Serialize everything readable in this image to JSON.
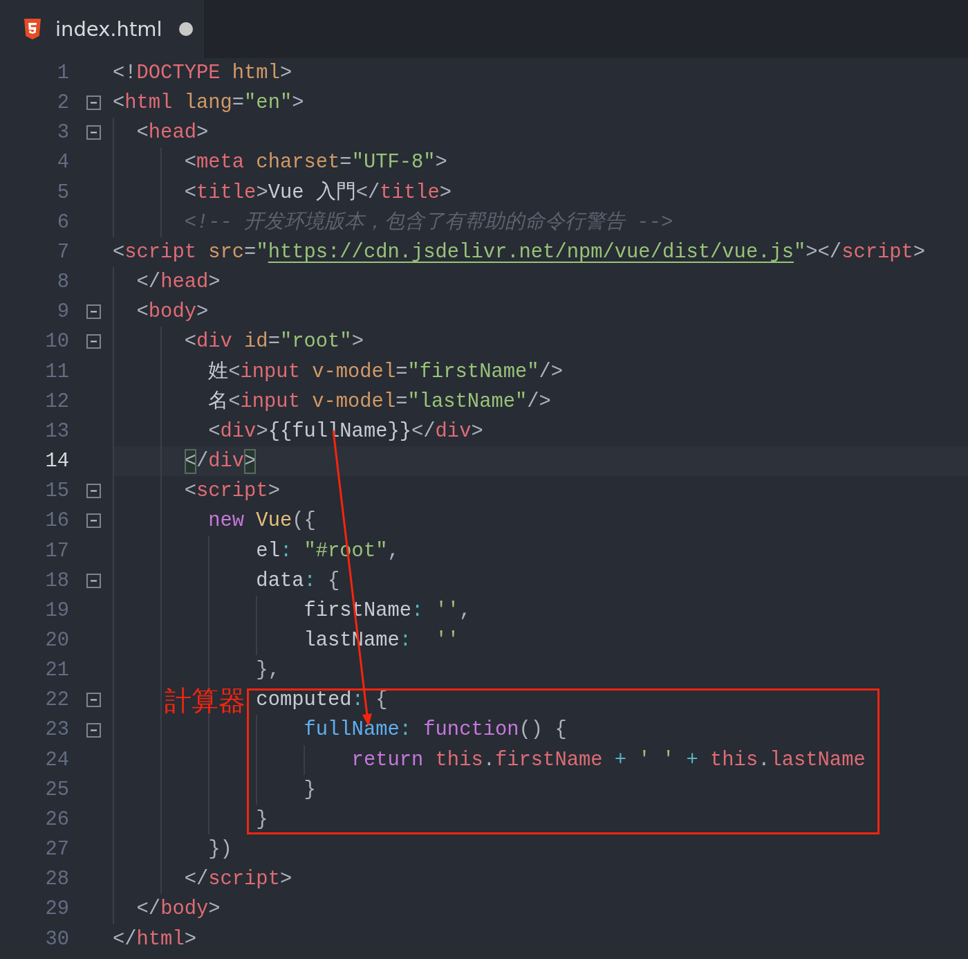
{
  "tab": {
    "filename": "index.html",
    "selected": true,
    "modified": true
  },
  "lines": [
    {
      "number": "1",
      "fold": false,
      "selected": false,
      "tokens": [
        {
          "text": "<!",
          "kind": "punct"
        },
        {
          "text": "DOCTYPE",
          "kind": "tag"
        },
        {
          "text": " html",
          "kind": "attr"
        },
        {
          "text": ">",
          "kind": "punct"
        }
      ]
    },
    {
      "number": "2",
      "fold": true,
      "selected": false,
      "tokens": [
        {
          "text": "<",
          "kind": "punct"
        },
        {
          "text": "html",
          "kind": "tag"
        },
        {
          "text": " lang",
          "kind": "attr"
        },
        {
          "text": "=",
          "kind": "punct"
        },
        {
          "text": "\"en\"",
          "kind": "string"
        },
        {
          "text": ">",
          "kind": "punct"
        }
      ]
    },
    {
      "number": "3",
      "fold": true,
      "selected": false,
      "tokens": [
        {
          "text": "  <",
          "kind": "punct"
        },
        {
          "text": "head",
          "kind": "tag"
        },
        {
          "text": ">",
          "kind": "punct"
        }
      ]
    },
    {
      "number": "4",
      "fold": false,
      "selected": false,
      "tokens": [
        {
          "text": "      <",
          "kind": "punct"
        },
        {
          "text": "meta",
          "kind": "tag"
        },
        {
          "text": " charset",
          "kind": "attr"
        },
        {
          "text": "=",
          "kind": "punct"
        },
        {
          "text": "\"UTF-8\"",
          "kind": "string"
        },
        {
          "text": ">",
          "kind": "punct"
        }
      ]
    },
    {
      "number": "5",
      "fold": false,
      "selected": false,
      "tokens": [
        {
          "text": "      <",
          "kind": "punct"
        },
        {
          "text": "title",
          "kind": "tag"
        },
        {
          "text": ">",
          "kind": "punct"
        },
        {
          "text": "Vue 入門",
          "kind": "text"
        },
        {
          "text": "</",
          "kind": "punct"
        },
        {
          "text": "title",
          "kind": "tag"
        },
        {
          "text": ">",
          "kind": "punct"
        }
      ]
    },
    {
      "number": "6",
      "fold": false,
      "selected": false,
      "tokens": [
        {
          "text": "      <!-- 开发环境版本，包含了有帮助的命令行警告 -->",
          "kind": "comment"
        }
      ]
    },
    {
      "number": "7",
      "fold": false,
      "selected": false,
      "tokens": [
        {
          "text": "<",
          "kind": "punct"
        },
        {
          "text": "script",
          "kind": "tag"
        },
        {
          "text": " src",
          "kind": "attr"
        },
        {
          "text": "=",
          "kind": "punct"
        },
        {
          "text": "\"",
          "kind": "string"
        },
        {
          "text": "https://cdn.jsdelivr.net/npm/vue/dist/vue.js",
          "kind": "link"
        },
        {
          "text": "\"",
          "kind": "string"
        },
        {
          "text": "></",
          "kind": "punct"
        },
        {
          "text": "script",
          "kind": "tag"
        },
        {
          "text": ">",
          "kind": "punct"
        }
      ]
    },
    {
      "number": "8",
      "fold": false,
      "selected": false,
      "tokens": [
        {
          "text": "  </",
          "kind": "punct"
        },
        {
          "text": "head",
          "kind": "tag"
        },
        {
          "text": ">",
          "kind": "punct"
        }
      ]
    },
    {
      "number": "9",
      "fold": true,
      "selected": false,
      "tokens": [
        {
          "text": "  <",
          "kind": "punct"
        },
        {
          "text": "body",
          "kind": "tag"
        },
        {
          "text": ">",
          "kind": "punct"
        }
      ]
    },
    {
      "number": "10",
      "fold": true,
      "selected": false,
      "tokens": [
        {
          "text": "      <",
          "kind": "punct"
        },
        {
          "text": "div",
          "kind": "tag"
        },
        {
          "text": " id",
          "kind": "attr"
        },
        {
          "text": "=",
          "kind": "punct"
        },
        {
          "text": "\"root\"",
          "kind": "string"
        },
        {
          "text": ">",
          "kind": "punct"
        }
      ]
    },
    {
      "number": "11",
      "fold": false,
      "selected": false,
      "tokens": [
        {
          "text": "        姓",
          "kind": "text"
        },
        {
          "text": "<",
          "kind": "punct"
        },
        {
          "text": "input",
          "kind": "tag"
        },
        {
          "text": " v-model",
          "kind": "attr"
        },
        {
          "text": "=",
          "kind": "punct"
        },
        {
          "text": "\"firstName\"",
          "kind": "string"
        },
        {
          "text": "/>",
          "kind": "punct"
        }
      ]
    },
    {
      "number": "12",
      "fold": false,
      "selected": false,
      "tokens": [
        {
          "text": "        名",
          "kind": "text"
        },
        {
          "text": "<",
          "kind": "punct"
        },
        {
          "text": "input",
          "kind": "tag"
        },
        {
          "text": " v-model",
          "kind": "attr"
        },
        {
          "text": "=",
          "kind": "punct"
        },
        {
          "text": "\"lastName\"",
          "kind": "string"
        },
        {
          "text": "/>",
          "kind": "punct"
        }
      ]
    },
    {
      "number": "13",
      "fold": false,
      "selected": false,
      "tokens": [
        {
          "text": "        <",
          "kind": "punct"
        },
        {
          "text": "div",
          "kind": "tag"
        },
        {
          "text": ">",
          "kind": "punct"
        },
        {
          "text": "{{fullName}}",
          "kind": "text"
        },
        {
          "text": "</",
          "kind": "punct"
        },
        {
          "text": "div",
          "kind": "tag"
        },
        {
          "text": ">",
          "kind": "punct"
        }
      ]
    },
    {
      "number": "14",
      "fold": false,
      "selected": true,
      "tokens": [
        {
          "text": "      <",
          "kind": "match"
        },
        {
          "text": "/",
          "kind": "punct"
        },
        {
          "text": "div",
          "kind": "tag"
        },
        {
          "text": ">",
          "kind": "match"
        }
      ]
    },
    {
      "number": "15",
      "fold": true,
      "selected": false,
      "tokens": [
        {
          "text": "      <",
          "kind": "punct"
        },
        {
          "text": "script",
          "kind": "tag"
        },
        {
          "text": ">",
          "kind": "punct"
        }
      ]
    },
    {
      "number": "16",
      "fold": true,
      "selected": false,
      "tokens": [
        {
          "text": "        new",
          "kind": "keyword"
        },
        {
          "text": " Vue",
          "kind": "class"
        },
        {
          "text": "({",
          "kind": "punct"
        }
      ]
    },
    {
      "number": "17",
      "fold": false,
      "selected": false,
      "tokens": [
        {
          "text": "            el",
          "kind": "text"
        },
        {
          "text": ":",
          "kind": "operator"
        },
        {
          "text": " \"#root\"",
          "kind": "string"
        },
        {
          "text": ",",
          "kind": "punct"
        }
      ]
    },
    {
      "number": "18",
      "fold": true,
      "selected": false,
      "tokens": [
        {
          "text": "            data",
          "kind": "text"
        },
        {
          "text": ":",
          "kind": "operator"
        },
        {
          "text": " {",
          "kind": "punct"
        }
      ]
    },
    {
      "number": "19",
      "fold": false,
      "selected": false,
      "tokens": [
        {
          "text": "                firstName",
          "kind": "text"
        },
        {
          "text": ":",
          "kind": "operator"
        },
        {
          "text": " ''",
          "kind": "string"
        },
        {
          "text": ",",
          "kind": "punct"
        }
      ]
    },
    {
      "number": "20",
      "fold": false,
      "selected": false,
      "tokens": [
        {
          "text": "                lastName",
          "kind": "text"
        },
        {
          "text": ":",
          "kind": "operator"
        },
        {
          "text": "  ''",
          "kind": "string"
        }
      ]
    },
    {
      "number": "21",
      "fold": false,
      "selected": false,
      "tokens": [
        {
          "text": "            },",
          "kind": "punct"
        }
      ]
    },
    {
      "number": "22",
      "fold": true,
      "selected": false,
      "tokens": [
        {
          "text": "            computed",
          "kind": "text"
        },
        {
          "text": ":",
          "kind": "operator"
        },
        {
          "text": " {",
          "kind": "punct"
        }
      ]
    },
    {
      "number": "23",
      "fold": true,
      "selected": false,
      "tokens": [
        {
          "text": "                fullName",
          "kind": "property"
        },
        {
          "text": ":",
          "kind": "operator"
        },
        {
          "text": " function",
          "kind": "keyword"
        },
        {
          "text": "() {",
          "kind": "punct"
        }
      ]
    },
    {
      "number": "24",
      "fold": false,
      "selected": false,
      "tokens": [
        {
          "text": "                    return",
          "kind": "keyword"
        },
        {
          "text": " this",
          "kind": "tag"
        },
        {
          "text": ".",
          "kind": "punct"
        },
        {
          "text": "firstName",
          "kind": "tag"
        },
        {
          "text": " +",
          "kind": "operator"
        },
        {
          "text": " ' '",
          "kind": "string"
        },
        {
          "text": " +",
          "kind": "operator"
        },
        {
          "text": " this",
          "kind": "tag"
        },
        {
          "text": ".",
          "kind": "punct"
        },
        {
          "text": "lastName",
          "kind": "tag"
        }
      ]
    },
    {
      "number": "25",
      "fold": false,
      "selected": false,
      "tokens": [
        {
          "text": "                }",
          "kind": "punct"
        }
      ]
    },
    {
      "number": "26",
      "fold": false,
      "selected": false,
      "tokens": [
        {
          "text": "            }",
          "kind": "punct"
        }
      ]
    },
    {
      "number": "27",
      "fold": false,
      "selected": false,
      "tokens": [
        {
          "text": "        })",
          "kind": "punct"
        }
      ]
    },
    {
      "number": "28",
      "fold": false,
      "selected": false,
      "tokens": [
        {
          "text": "      </",
          "kind": "punct"
        },
        {
          "text": "script",
          "kind": "tag"
        },
        {
          "text": ">",
          "kind": "punct"
        }
      ]
    },
    {
      "number": "29",
      "fold": false,
      "selected": false,
      "tokens": [
        {
          "text": "  </",
          "kind": "punct"
        },
        {
          "text": "body",
          "kind": "tag"
        },
        {
          "text": ">",
          "kind": "punct"
        }
      ]
    },
    {
      "number": "30",
      "fold": false,
      "selected": false,
      "tokens": [
        {
          "text": "</",
          "kind": "punct"
        },
        {
          "text": "html",
          "kind": "tag"
        },
        {
          "text": ">",
          "kind": "punct"
        }
      ]
    }
  ],
  "annotation": {
    "label": "計算器"
  }
}
